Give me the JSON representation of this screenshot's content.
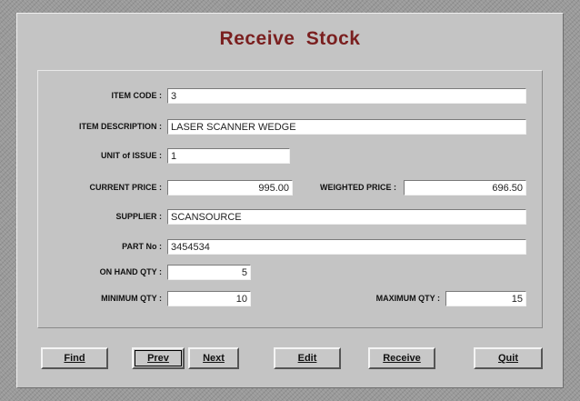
{
  "title": "Receive Stock",
  "fields": {
    "item_code": {
      "label": "ITEM CODE :",
      "value": "3"
    },
    "item_description": {
      "label": "ITEM DESCRIPTION :",
      "value": "LASER SCANNER WEDGE"
    },
    "unit_of_issue": {
      "label": "UNIT of ISSUE :",
      "value": "1"
    },
    "current_price": {
      "label": "CURRENT PRICE :",
      "value": "995.00"
    },
    "weighted_price": {
      "label": "WEIGHTED PRICE :",
      "value": "696.50"
    },
    "supplier": {
      "label": "SUPPLIER :",
      "value": "SCANSOURCE"
    },
    "part_no": {
      "label": "PART No :",
      "value": "3454534"
    },
    "on_hand_qty": {
      "label": "ON HAND QTY :",
      "value": "5"
    },
    "minimum_qty": {
      "label": "MINIMUM QTY :",
      "value": "10"
    },
    "maximum_qty": {
      "label": "MAXIMUM QTY :",
      "value": "15"
    }
  },
  "buttons": {
    "find": "Find",
    "prev": "Prev",
    "next": "Next",
    "edit": "Edit",
    "receive": "Receive",
    "quit": "Quit"
  }
}
